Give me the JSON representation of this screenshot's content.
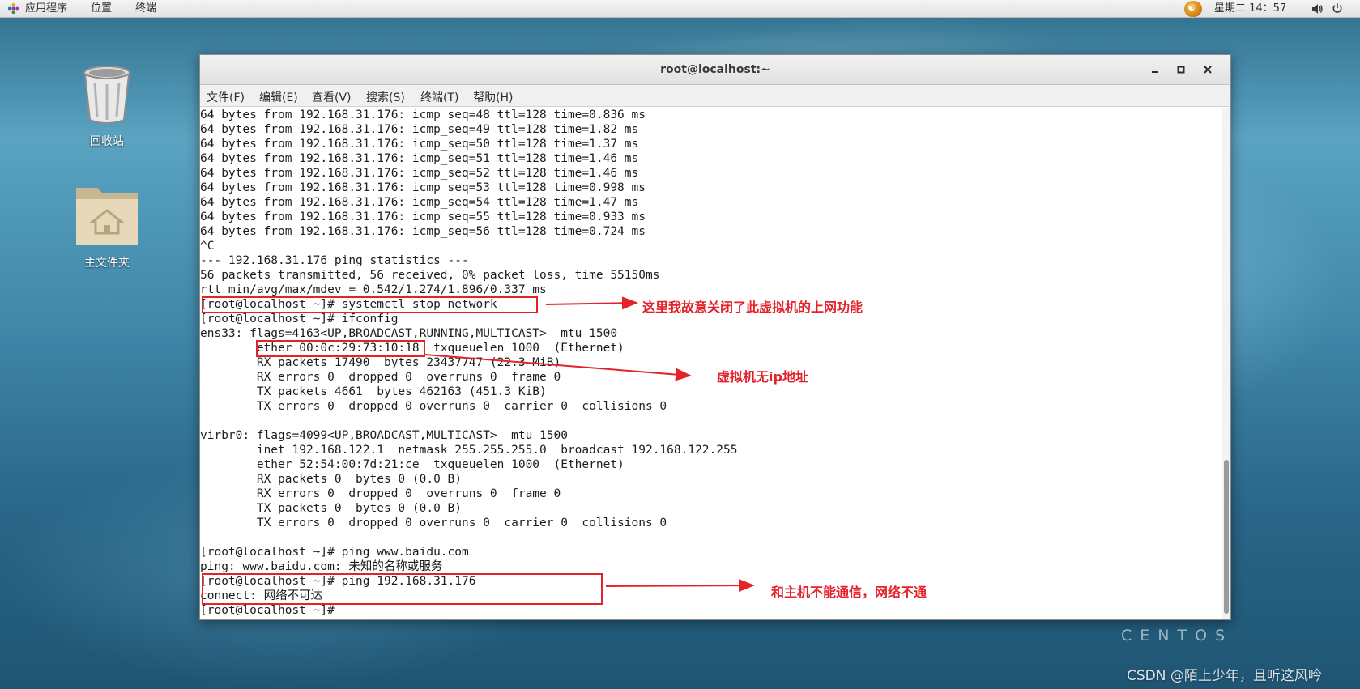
{
  "topbar": {
    "menu": [
      "应用程序",
      "位置",
      "终端"
    ],
    "clock": "星期二 14：57"
  },
  "desktop": {
    "trash_label": "回收站",
    "home_label": "主文件夹",
    "centos_mark": "CENTOS",
    "watermark": "CSDN @陌上少年，且听这风吟"
  },
  "window": {
    "title": "root@localhost:~",
    "menu": [
      "文件(F)",
      "编辑(E)",
      "查看(V)",
      "搜索(S)",
      "终端(T)",
      "帮助(H)"
    ]
  },
  "terminal": {
    "lines": [
      "64 bytes from 192.168.31.176: icmp_seq=48 ttl=128 time=0.836 ms",
      "64 bytes from 192.168.31.176: icmp_seq=49 ttl=128 time=1.82 ms",
      "64 bytes from 192.168.31.176: icmp_seq=50 ttl=128 time=1.37 ms",
      "64 bytes from 192.168.31.176: icmp_seq=51 ttl=128 time=1.46 ms",
      "64 bytes from 192.168.31.176: icmp_seq=52 ttl=128 time=1.46 ms",
      "64 bytes from 192.168.31.176: icmp_seq=53 ttl=128 time=0.998 ms",
      "64 bytes from 192.168.31.176: icmp_seq=54 ttl=128 time=1.47 ms",
      "64 bytes from 192.168.31.176: icmp_seq=55 ttl=128 time=0.933 ms",
      "64 bytes from 192.168.31.176: icmp_seq=56 ttl=128 time=0.724 ms",
      "^C",
      "--- 192.168.31.176 ping statistics ---",
      "56 packets transmitted, 56 received, 0% packet loss, time 55150ms",
      "rtt min/avg/max/mdev = 0.542/1.274/1.896/0.337 ms",
      "[root@localhost ~]# systemctl stop network",
      "[root@localhost ~]# ifconfig",
      "ens33: flags=4163<UP,BROADCAST,RUNNING,MULTICAST>  mtu 1500",
      "        ether 00:0c:29:73:10:18  txqueuelen 1000  (Ethernet)",
      "        RX packets 17490  bytes 23437747 (22.3 MiB)",
      "        RX errors 0  dropped 0  overruns 0  frame 0",
      "        TX packets 4661  bytes 462163 (451.3 KiB)",
      "        TX errors 0  dropped 0 overruns 0  carrier 0  collisions 0",
      "",
      "virbr0: flags=4099<UP,BROADCAST,MULTICAST>  mtu 1500",
      "        inet 192.168.122.1  netmask 255.255.255.0  broadcast 192.168.122.255",
      "        ether 52:54:00:7d:21:ce  txqueuelen 1000  (Ethernet)",
      "        RX packets 0  bytes 0 (0.0 B)",
      "        RX errors 0  dropped 0  overruns 0  frame 0",
      "        TX packets 0  bytes 0 (0.0 B)",
      "        TX errors 0  dropped 0 overruns 0  carrier 0  collisions 0",
      "",
      "[root@localhost ~]# ping www.baidu.com",
      "ping: www.baidu.com: 未知的名称或服务",
      "[root@localhost ~]# ping 192.168.31.176",
      "connect: 网络不可达",
      "[root@localhost ~]#"
    ]
  },
  "annotations": {
    "network_off": "这里我故意关闭了此虚拟机的上网功能",
    "no_ip": "虚拟机无ip地址",
    "no_host": "和主机不能通信，网络不通"
  },
  "colors": {
    "annotation": "#e4222a",
    "desktop": "#3f86a8"
  }
}
